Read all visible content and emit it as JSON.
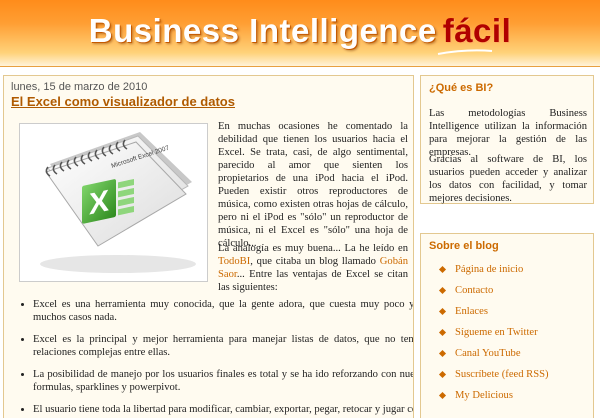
{
  "header": {
    "title": "Business Intelligence",
    "accent": "fácil"
  },
  "post": {
    "date": "lunes, 15 de marzo de 2010",
    "title": "El Excel como visualizador de datos",
    "image_label": "Microsoft Excel 2007",
    "p1": "En muchas ocasiones he comentado la debilidad que tienen los usuarios hacia el Excel. Se trata, casi, de algo sentimental, parecido al amor que sienten los propietarios de una iPod hacia el iPod. Pueden existir otros reproductores de música, como existen otras hojas de cálculo, pero ni el iPod es \"sólo\" un reproductor de música, ni el Excel es \"sólo\" una hoja de cálculo...",
    "p2_a": "La analogía es muy buena... La he leído en ",
    "p2_link1": "TodoBI",
    "p2_b": ", que citaba un blog llamado ",
    "p2_link2": "Gobán Saor",
    "p2_c": "... Entre las ventajas de Excel se citan las siguientes:",
    "bullets": [
      "Excel es una herramienta muy conocida, que la gente adora, que cuesta muy poco y en muchos casos nada.",
      "Excel es la principal y mejor herramienta para manejar listas de datos, que no tengan relaciones complejas entre ellas.",
      "La posibilidad de manejo por los usuarios finales es total y se ha ido reforzando con nuevas formulas, sparklines y powerpivot.",
      "El usuario tiene toda la libertad para modificar, cambiar, exportar, pegar, retocar y jugar con"
    ]
  },
  "sidebar": {
    "box1": {
      "title": "¿Qué es BI?",
      "text1": "Las metodologías Business Intelligence utilizan la información para mejorar la gestión de las empresas.",
      "text2": "Gracias al software de BI, los usuarios pueden acceder y analizar los datos con facilidad, y tomar mejores decisiones."
    },
    "box2": {
      "title": "Sobre el blog",
      "items": [
        "Página de inicio",
        "Contacto",
        "Enlaces",
        "Sígueme en Twitter",
        "Canal YouTube",
        "Suscríbete (feed RSS)",
        "My Delicious"
      ]
    }
  },
  "colors": {
    "accent": "#cc6a00",
    "header_orange": "#ff8c1a",
    "panel_bg": "#fffbf0",
    "panel_border": "#e3c890"
  }
}
